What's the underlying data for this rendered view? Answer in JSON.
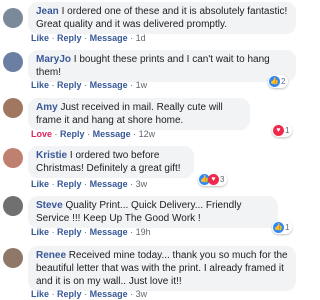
{
  "actions": {
    "like": "Like",
    "love": "Love",
    "reply": "Reply",
    "message": "Message",
    "sep": "·"
  },
  "comments": [
    {
      "name": "Jean",
      "text": "I ordered one of these and it is absolutely fantastic! Great quality and it was delivered promptly.",
      "reaction": "Like",
      "time": "1d",
      "avatar_color": "#7a8a9a"
    },
    {
      "name": "MaryJo",
      "text": "I bought these prints and I can't wait to hang them!",
      "reaction": "Like",
      "time": "1w",
      "reaction_count": "2",
      "avatar_color": "#6b7fa3"
    },
    {
      "name": "Amy",
      "text": "Just received in mail. Really cute will frame it and hang at shore home.",
      "reaction": "Love",
      "time": "12w",
      "reaction_count": "1",
      "avatar_color": "#a07860"
    },
    {
      "name": "Kristie",
      "text": "I ordered two before Christmas! Definitely a great gift!",
      "reaction": "Like",
      "time": "3w",
      "reaction_count": "3",
      "avatar_color": "#c08070"
    },
    {
      "name": "Steve",
      "text": "Quality Print... Quick Delivery... Friendly Service !!! Keep Up The Good Work !",
      "reaction": "Like",
      "time": "19h",
      "reaction_count": "1",
      "avatar_color": "#707070"
    },
    {
      "name": "Renee",
      "text": "Received mine today... thank you so much for the beautiful letter that was with the print. I already framed it and it is on my wall.. Just love it!!",
      "reaction": "Like",
      "time": "3w",
      "avatar_color": "#907868"
    }
  ]
}
